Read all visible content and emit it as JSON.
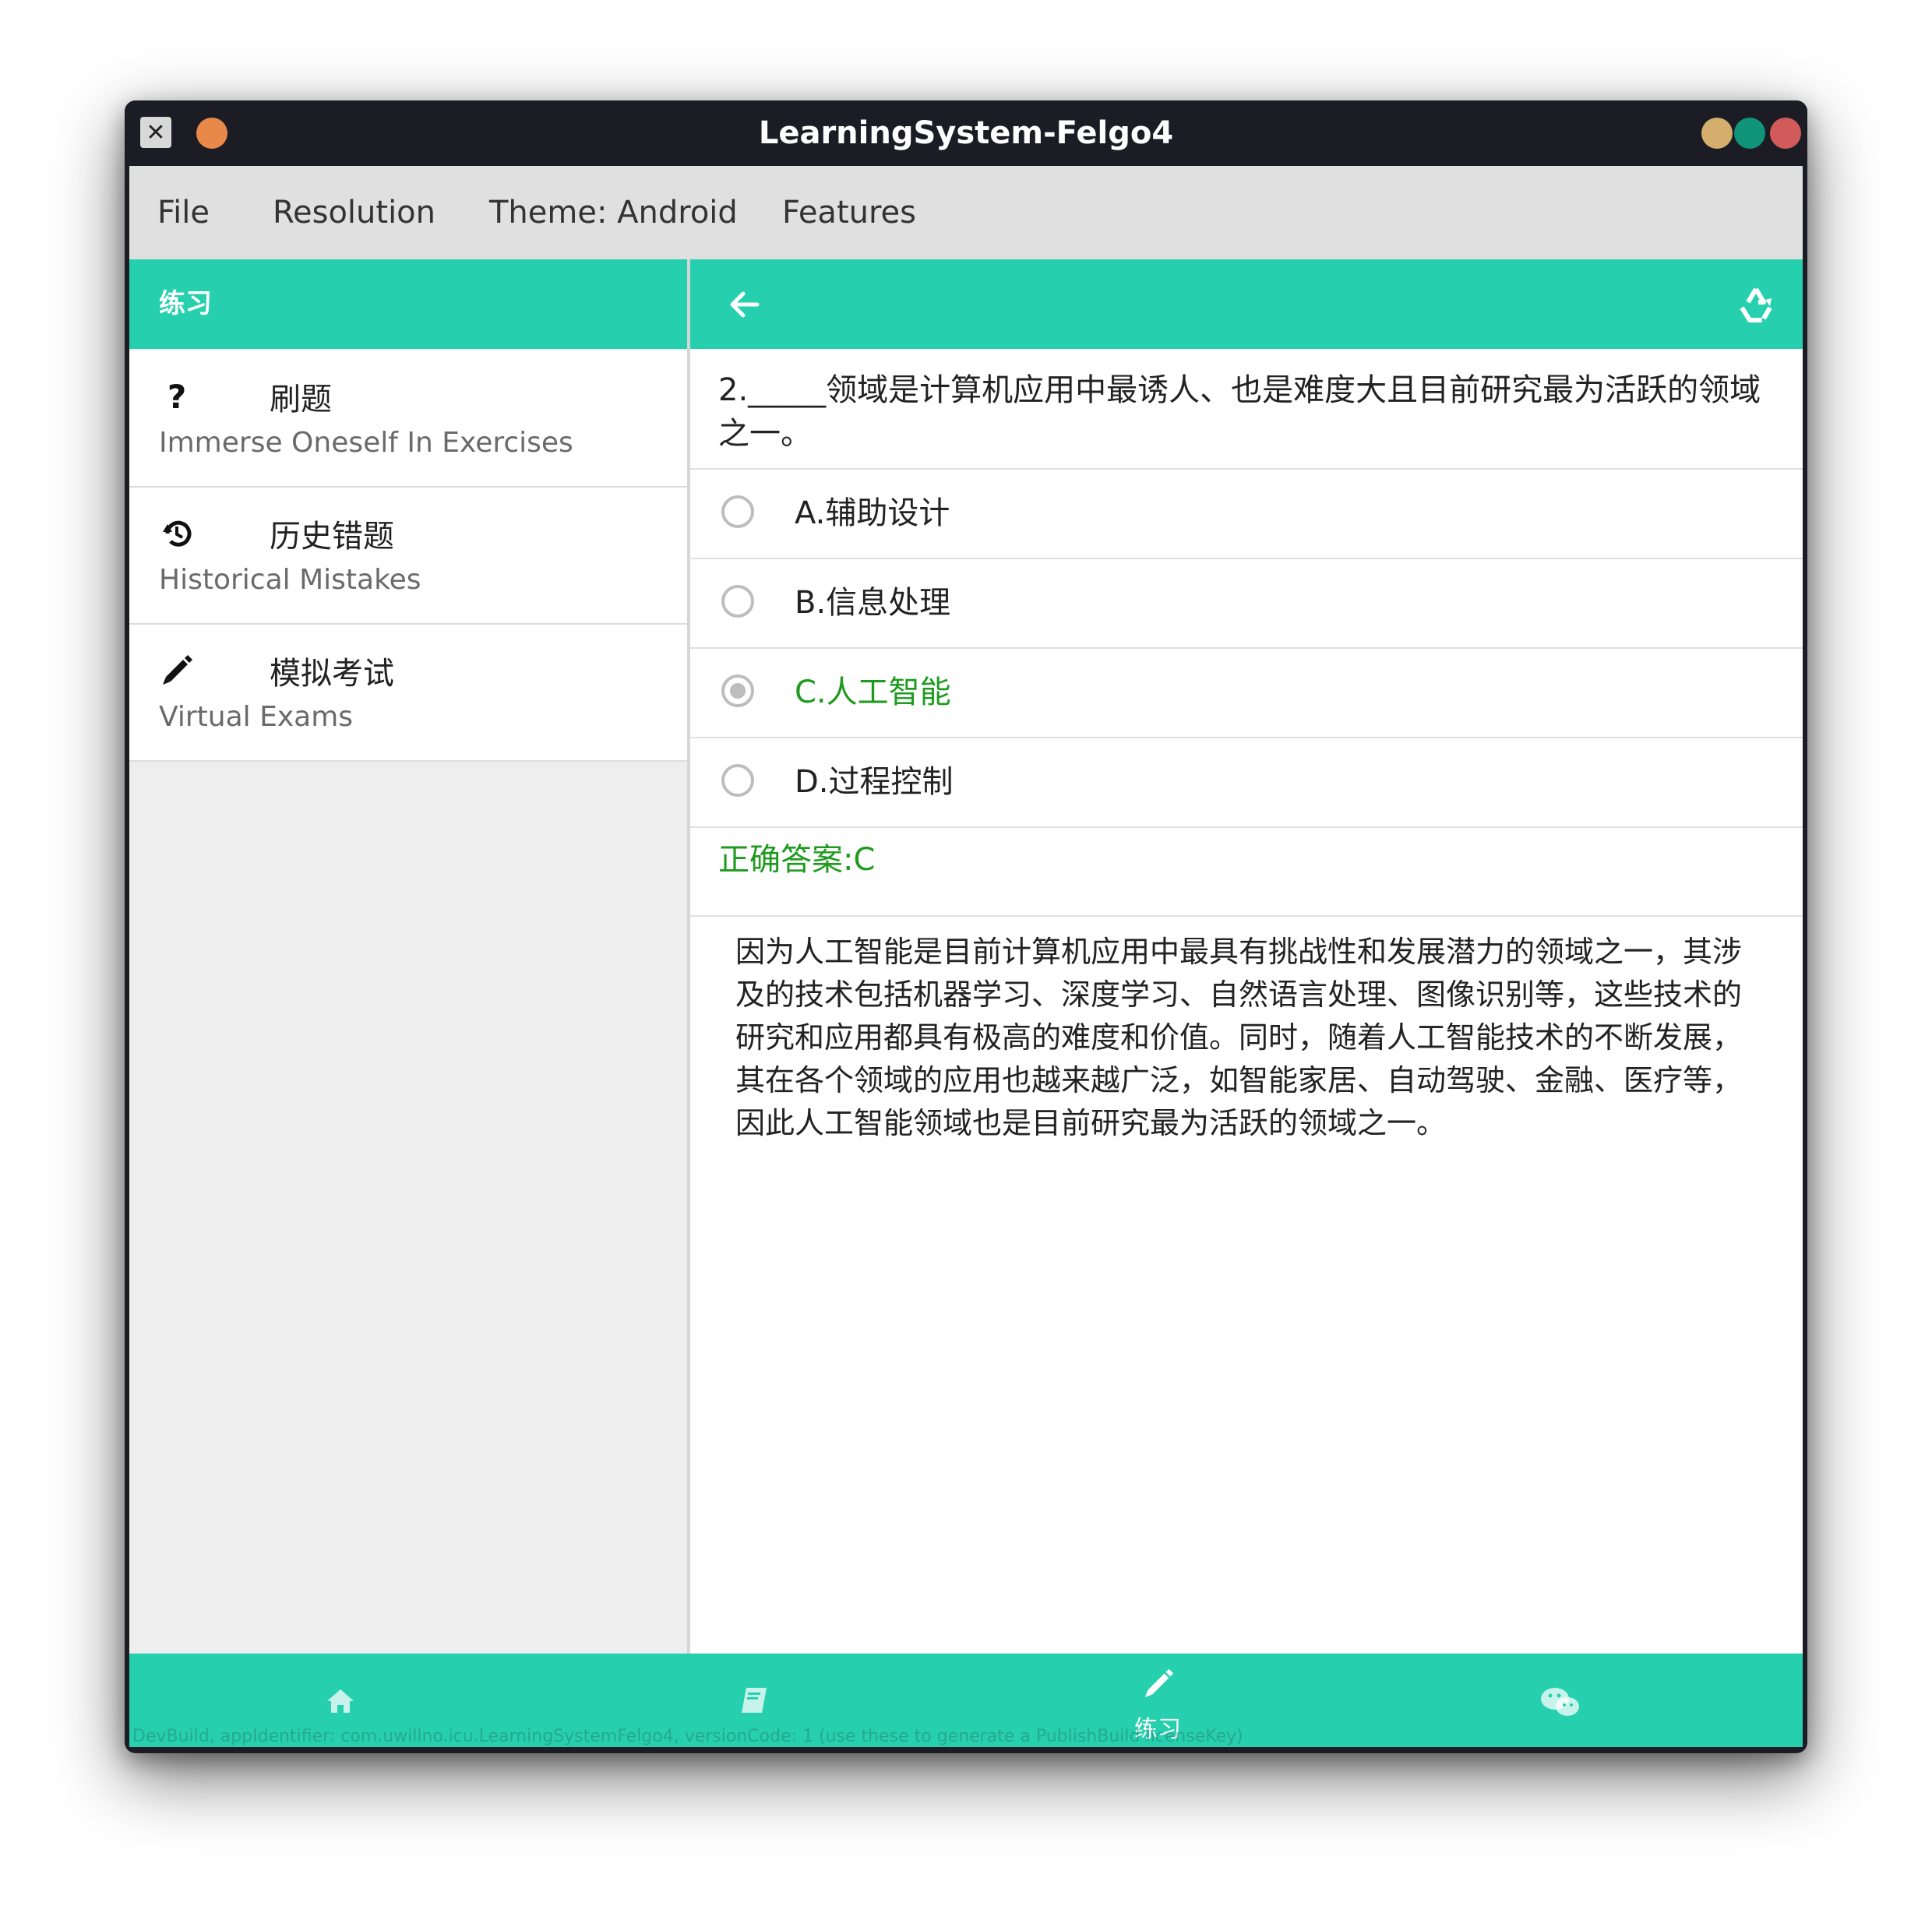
{
  "window": {
    "title": "LearningSystem-Felgo4",
    "app_icon": "x-app-icon",
    "title_dots": [
      "#e8894a",
      "#d4ae6c",
      "#11957a",
      "#d35a5a"
    ]
  },
  "menubar": {
    "items": [
      "File",
      "Resolution",
      "Theme: Android",
      "Features"
    ]
  },
  "left": {
    "header_title": "练习",
    "rows": [
      {
        "icon": "question-icon",
        "title": "刷题",
        "subtitle": "Immerse Oneself In Exercises"
      },
      {
        "icon": "history-icon",
        "title": "历史错题",
        "subtitle": "Historical Mistakes"
      },
      {
        "icon": "pencil-icon",
        "title": "模拟考试",
        "subtitle": "Virtual Exams"
      }
    ]
  },
  "right": {
    "question": "2._____领域是计算机应用中最诱人、也是难度大且目前研究最为活跃的领域之一。",
    "options": [
      {
        "label": "A.辅助设计",
        "selected": false
      },
      {
        "label": "B.信息处理",
        "selected": false
      },
      {
        "label": "C.人工智能",
        "selected": true
      },
      {
        "label": "D.过程控制",
        "selected": false
      }
    ],
    "answer": "正确答案:C",
    "explanation": "因为人工智能是目前计算机应用中最具有挑战性和发展潜力的领域之一，其涉及的技术包括机器学习、深度学习、自然语言处理、图像识别等，这些技术的研究和应用都具有极高的难度和价值。同时，随着人工智能技术的不断发展，其在各个领域的应用也越来越广泛，如智能家居、自动驾驶、金融、医疗等，因此人工智能领域也是目前研究最为活跃的领域之一。"
  },
  "bottom_nav": {
    "items": [
      {
        "icon": "home-icon",
        "label": ""
      },
      {
        "icon": "book-icon",
        "label": ""
      },
      {
        "icon": "pencil-icon",
        "label": "练习"
      },
      {
        "icon": "wechat-icon",
        "label": ""
      }
    ],
    "watermark": "DevBuild, appIdentifier: com.uwillno.icu.LearningSystemFelgo4, versionCode: 1 (use these to generate a PublishBuild licenseKey)"
  },
  "colors": {
    "accent": "#26d0ae",
    "correct": "#1e9b1e",
    "titlebar": "#1c1d24"
  }
}
